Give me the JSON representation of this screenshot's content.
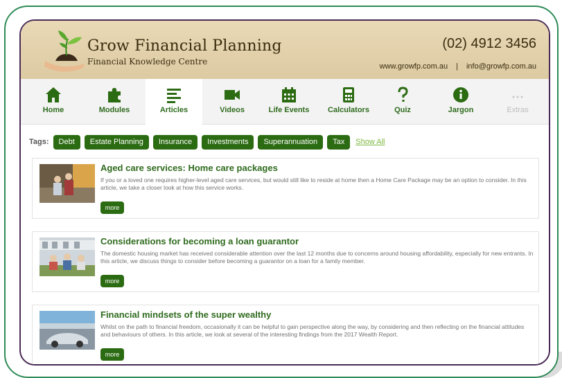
{
  "header": {
    "title": "Grow Financial Planning",
    "subtitle": "Financial Knowledge Centre",
    "phone": "(02) 4912 3456",
    "website": "www.growfp.com.au",
    "separator": "|",
    "email": "info@growfp.com.au"
  },
  "nav": {
    "items": [
      {
        "label": "Home",
        "icon": "home-icon"
      },
      {
        "label": "Modules",
        "icon": "puzzle-icon"
      },
      {
        "label": "Articles",
        "icon": "list-icon",
        "active": true
      },
      {
        "label": "Videos",
        "icon": "video-camera-icon"
      },
      {
        "label": "Life Events",
        "icon": "calendar-icon"
      },
      {
        "label": "Calculators",
        "icon": "calculator-icon"
      },
      {
        "label": "Quiz",
        "icon": "question-icon"
      },
      {
        "label": "Jargon",
        "icon": "info-icon"
      },
      {
        "label": "Extras",
        "icon": "more-dots-icon",
        "disabled": true
      }
    ]
  },
  "tags": {
    "label": "Tags:",
    "items": [
      "Debt",
      "Estate Planning",
      "Insurance",
      "Investments",
      "Superannuation",
      "Tax"
    ],
    "show_all": "Show All"
  },
  "articles": [
    {
      "title": "Aged care services: Home care packages",
      "description": "If you or a loved one requires higher-level aged care services, but would still like to reside at home then a Home Care Package may be an option to consider. In this article, we take a closer look at how this service works.",
      "button": "more"
    },
    {
      "title": "Considerations for becoming a loan guarantor",
      "description": "The domestic housing market has received considerable attention over the last 12 months due to concerns around housing affordability, especially for new entrants. In this article, we discuss things to consider before becoming a guarantor on a loan for a family member.",
      "button": "more"
    },
    {
      "title": "Financial mindsets of the super wealthy",
      "description": "Whilst on the path to financial freedom, occasionally it can be helpful to gain perspective along the way, by considering and then reflecting on the financial attitudes and behaviours of others. In this article, we look at several of the interesting findings from the 2017 Wealth Report.",
      "button": "more"
    }
  ],
  "colors": {
    "brand_green": "#2b6b12",
    "nav_text": "#2f6b1e",
    "outer_border": "#2e8b57",
    "inner_border": "#4a2a55"
  }
}
